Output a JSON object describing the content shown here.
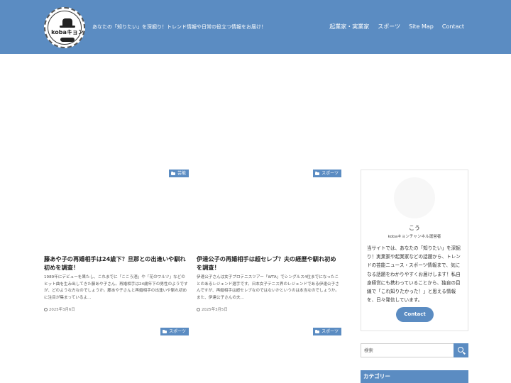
{
  "header": {
    "logo_text": "kobaキョン",
    "tagline": "あなたの「知りたい」を深掘り！トレンド情報や日常の役立つ情報をお届け！",
    "nav": [
      "起業家・実業家",
      "スポーツ",
      "Site Map",
      "Contact"
    ]
  },
  "posts": [
    {
      "category": "芸能",
      "title": "藤あや子の再婚相手は24歳下？旦那との出逢いや馴れ初めを調査！",
      "excerpt": "1989年にデビューを果たし、これまでに「こころ酒」や「花のワルツ」などのヒット曲を生み出してきた藤あや子さん。再婚相手は24歳年下の男性のようですが、どのような方なのでしょうか。藤あや子さんと再婚相手の出逢いや馴れ初めに注目が集まっているよ...",
      "date": "2025年3月6日"
    },
    {
      "category": "スポーツ",
      "title": "伊達公子の再婚相手は超セレブ？夫の経歴や馴れ初めを調査！",
      "excerpt": "伊達公子さんは女子プロテニスツアー「WTA」でシングルス4位までになったことのあるレジェンド選手です。日本女子テニス界のレジェンドである伊達公子さんですが、再婚相手は超セレブなのではないかというのは本当なのでしょうか。また、伊達公子さんの夫...",
      "date": "2025年3月5日"
    },
    {
      "category": "スポーツ"
    },
    {
      "category": "スポーツ"
    }
  ],
  "sidebar": {
    "profile_name": "こう",
    "profile_role": "kobaキョンチャンネル運営者",
    "profile_desc": "当サイトでは、あなたの「知りたい」を深掘り！実業家や起業家などの話題から、トレンドの芸能ニュース・スポーツ情報まで、気になる話題をわかりやすくお届けします！私自身経営にも携わっていることから、独自の目線で「これ知りたかった！」と思える情報を、日々発信しています。",
    "contact_label": "Contact",
    "search_placeholder": "検索",
    "category_heading": "カテゴリー"
  },
  "colors": {
    "accent": "#5b8cc2"
  }
}
